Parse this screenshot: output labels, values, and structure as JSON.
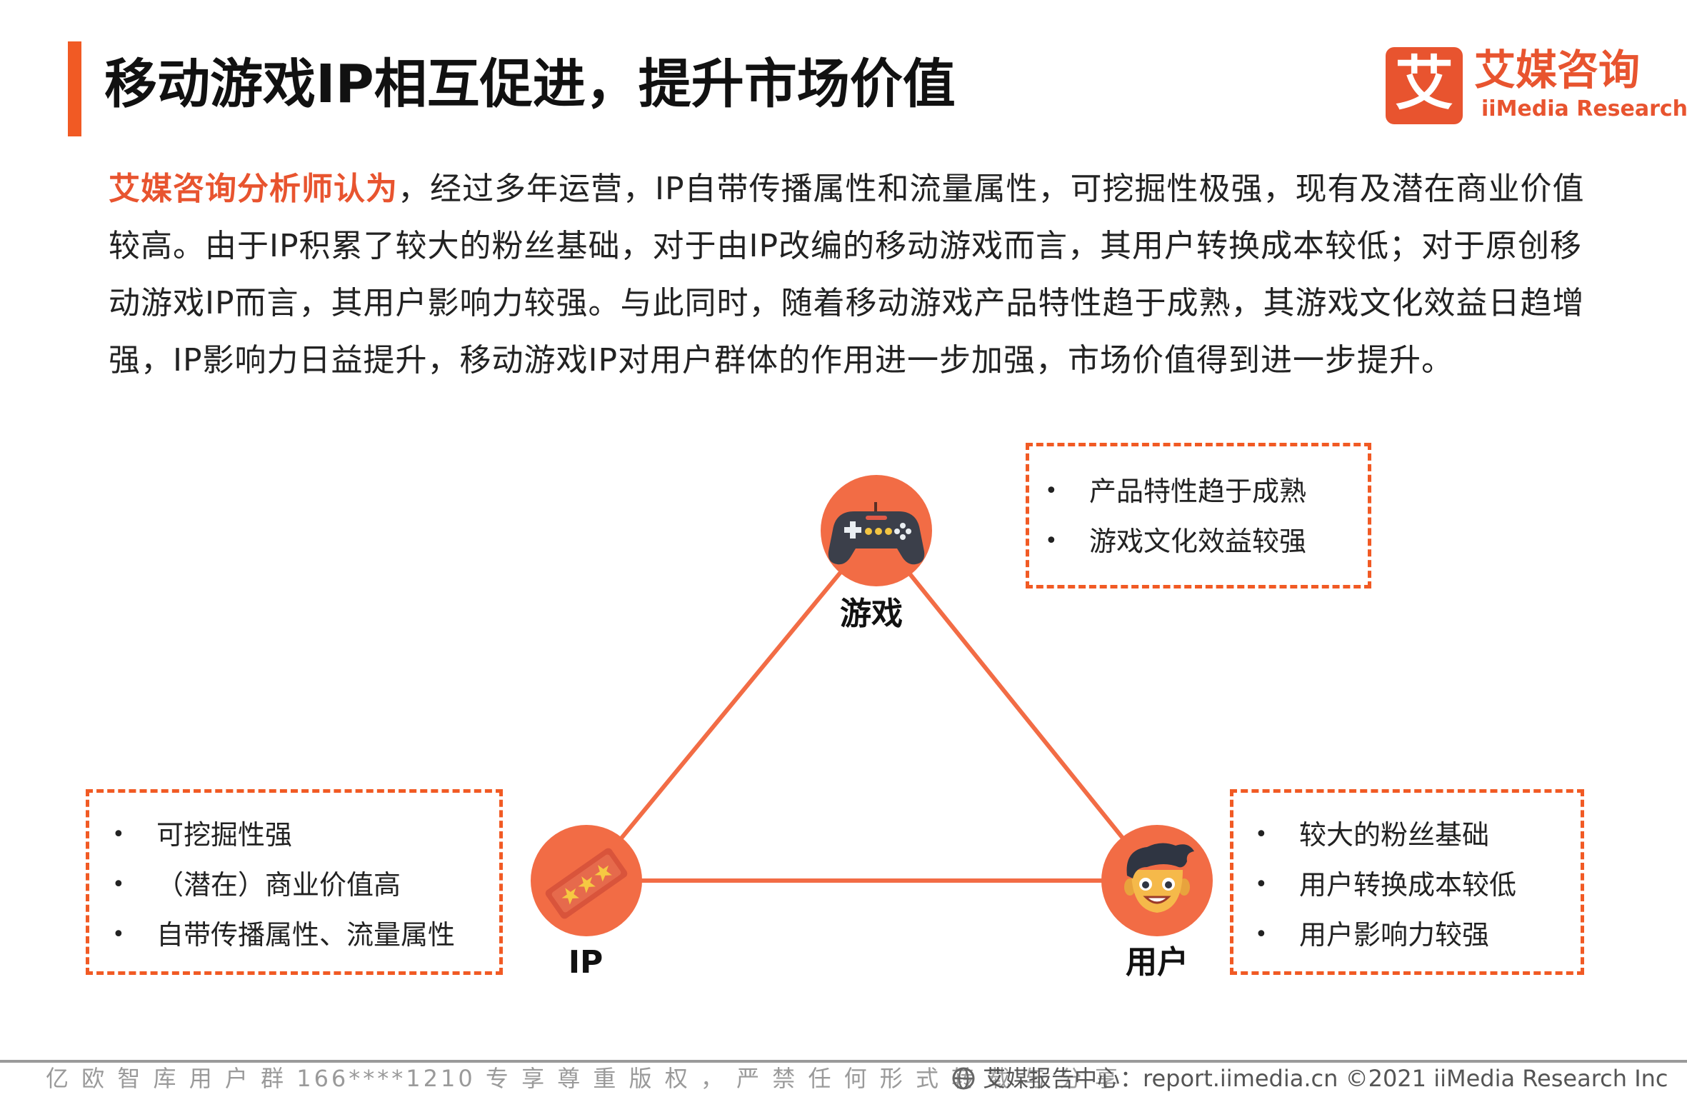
{
  "header": {
    "title": "移动游戏IP相互促进，提升市场价值",
    "accent_color": "#f15a24"
  },
  "logo": {
    "mark_char": "艾",
    "name_cn": "艾媒咨询",
    "name_en": "iiMedia Research",
    "color": "#e8542f"
  },
  "intro": {
    "lead": "艾媒咨询分析师认为",
    "text": "，经过多年运营，IP自带传播属性和流量属性，可挖掘性极强，现有及潜在商业价值较高。由于IP积累了较大的粉丝基础，对于由IP改编的移动游戏而言，其用户转换成本较低；对于原创移动游戏IP而言，其用户影响力较强。与此同时，随着移动游戏产品特性趋于成熟，其游戏文化效益日趋增强，IP影响力日益提升，移动游戏IP对用户群体的作用进一步加强，市场价值得到进一步提升。"
  },
  "diagram": {
    "nodes": {
      "game": {
        "label": "游戏",
        "icon": "gamepad-icon"
      },
      "ip": {
        "label": "IP",
        "icon": "stars-ticket-icon"
      },
      "user": {
        "label": "用户",
        "icon": "boy-face-icon"
      }
    },
    "boxes": {
      "game": [
        "产品特性趋于成熟",
        "游戏文化效益较强"
      ],
      "ip": [
        "可挖掘性强",
        "（潜在）商业价值高",
        "自带传播属性、流量属性"
      ],
      "user": [
        "较大的粉丝基础",
        "用户转换成本较低",
        "用户影响力较强"
      ]
    },
    "bullet": "•",
    "line_color": "#f26c45",
    "node_color": "#f26c45"
  },
  "footer": {
    "watermark": "亿 欧 智 库 用 户 群 166****1210 专 享 尊 重 版 权 ， 严 禁 任 何 形 式 转 载 与 分 享",
    "source": "艾媒报告中心：report.iimedia.cn ©2021 iiMedia Research Inc",
    "icon": "globe-icon"
  }
}
